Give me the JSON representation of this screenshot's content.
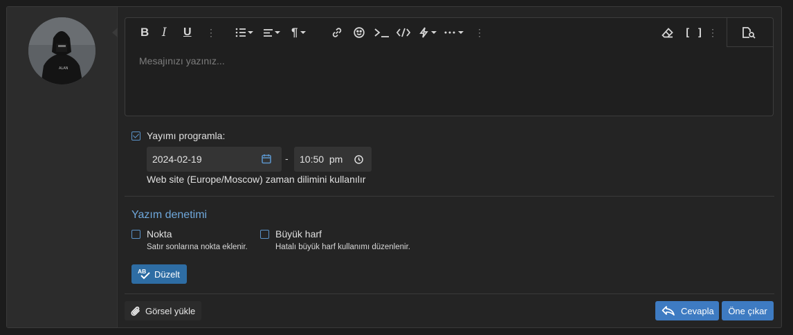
{
  "editor": {
    "placeholder": "Mesajınızı yazınız...",
    "toolbar": [
      {
        "name": "bold-icon",
        "glyph": "B"
      },
      {
        "name": "italic-icon",
        "glyph": "I"
      },
      {
        "name": "underline-icon",
        "glyph": "U"
      },
      {
        "name": "more-text-icon"
      },
      {
        "name": "list-icon"
      },
      {
        "name": "align-icon"
      },
      {
        "name": "paragraph-icon",
        "glyph": "¶"
      },
      {
        "name": "link-icon"
      },
      {
        "name": "emoji-icon"
      },
      {
        "name": "terminal-icon"
      },
      {
        "name": "code-icon"
      },
      {
        "name": "insert-icon"
      },
      {
        "name": "more-icon"
      },
      {
        "name": "more-vertical-icon"
      },
      {
        "name": "eraser-icon"
      },
      {
        "name": "bbcode-icon"
      },
      {
        "name": "more-right-icon"
      },
      {
        "name": "preview-icon"
      }
    ]
  },
  "schedule": {
    "checked": true,
    "label": "Yayımı programla:",
    "date": "2024-02-19",
    "time": "10:50  pm",
    "separator": "-",
    "timezone_note": "Web site (Europe/Moscow) zaman dilimini kullanılır"
  },
  "spellcheck": {
    "title": "Yazım denetimi",
    "options": [
      {
        "label": "Nokta",
        "description": "Satır sonlarına nokta eklenir.",
        "checked": false
      },
      {
        "label": "Büyük harf",
        "description": "Hatalı büyük harf kullanımı düzenlenir.",
        "checked": false
      }
    ],
    "fix_button": "Düzelt"
  },
  "footer": {
    "upload_button": "Görsel yükle",
    "reply_button": "Cevapla",
    "feature_button": "Öne çıkar"
  },
  "colors": {
    "accent": "#3e7bc2",
    "link": "#6fa8dc",
    "background": "#242424"
  }
}
